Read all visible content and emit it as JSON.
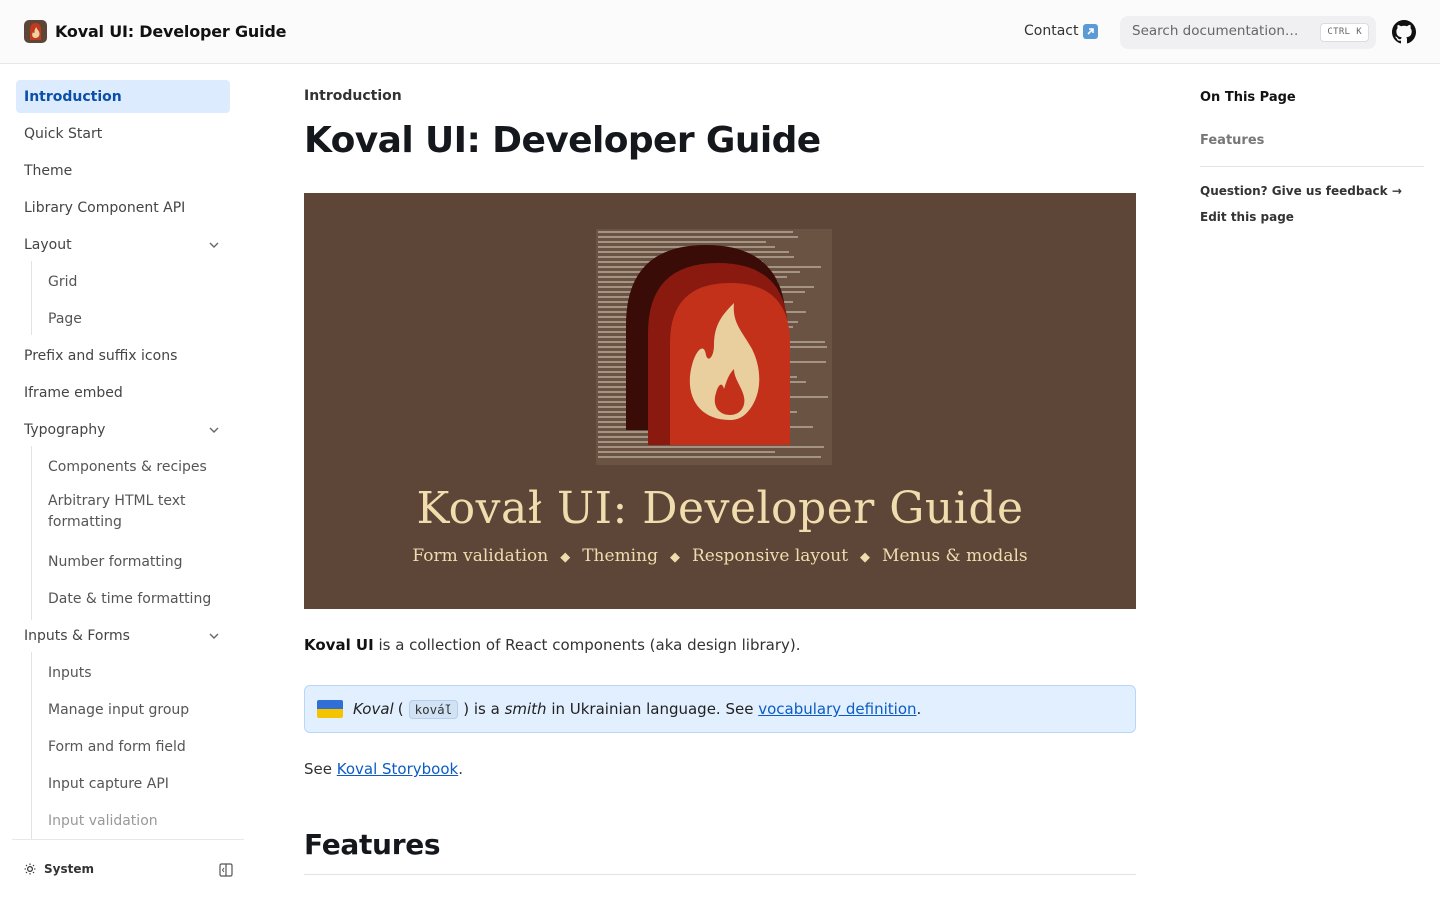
{
  "header": {
    "title": "Koval UI: Developer Guide",
    "contact_label": "Contact",
    "search_placeholder": "Search documentation…",
    "shortcut_key1": "CTRL",
    "shortcut_key2": "K"
  },
  "sidebar": {
    "items": [
      {
        "label": "Introduction"
      },
      {
        "label": "Quick Start"
      },
      {
        "label": "Theme"
      },
      {
        "label": "Library Component API"
      },
      {
        "label": "Layout"
      },
      {
        "label": "Grid"
      },
      {
        "label": "Page"
      },
      {
        "label": "Prefix and suffix icons"
      },
      {
        "label": "Iframe embed"
      },
      {
        "label": "Typography"
      },
      {
        "label": "Components & recipes"
      },
      {
        "label": "Arbitrary HTML text formatting"
      },
      {
        "label": "Number formatting"
      },
      {
        "label": "Date & time formatting"
      },
      {
        "label": "Inputs & Forms"
      },
      {
        "label": "Inputs"
      },
      {
        "label": "Manage input group"
      },
      {
        "label": "Form and form field"
      },
      {
        "label": "Input capture API"
      },
      {
        "label": "Input validation"
      }
    ],
    "theme_label": "System"
  },
  "main": {
    "breadcrumb": "Introduction",
    "title": "Koval UI: Developer Guide",
    "hero": {
      "title": "Kovał UI: Developer Guide",
      "features": [
        "Form validation",
        "Theming",
        "Responsive layout",
        "Menus & modals"
      ]
    },
    "intro_bold": "Koval UI",
    "intro_rest": " is a collection of React components (aka design library).",
    "callout": {
      "word": "Koval",
      "pronunciation": "ková́l",
      "mid": " is a ",
      "smith": "smith",
      "rest": " in Ukrainian language. See ",
      "link": "vocabulary definition",
      "end": "."
    },
    "see_prefix": "See ",
    "see_link": "Koval Storybook",
    "see_end": ".",
    "section_title": "Features"
  },
  "toc": {
    "title": "On This Page",
    "items": [
      "Features"
    ],
    "feedback": "Question? Give us feedback →",
    "edit": "Edit this page"
  },
  "colors": {
    "accent": "#0b5cc5",
    "active_bg": "#dcebfd",
    "hero_bg": "#5d4538",
    "hero_text": "#f1dcae",
    "callout_bg": "#e2efff"
  },
  "icons": {
    "logo": "flame-logo-icon",
    "external": "external-link-icon",
    "github": "github-icon",
    "theme": "sun-icon",
    "collapse": "sidebar-collapse-icon",
    "chevron": "chevron-down-icon",
    "flag": "ukraine-flag-icon"
  }
}
